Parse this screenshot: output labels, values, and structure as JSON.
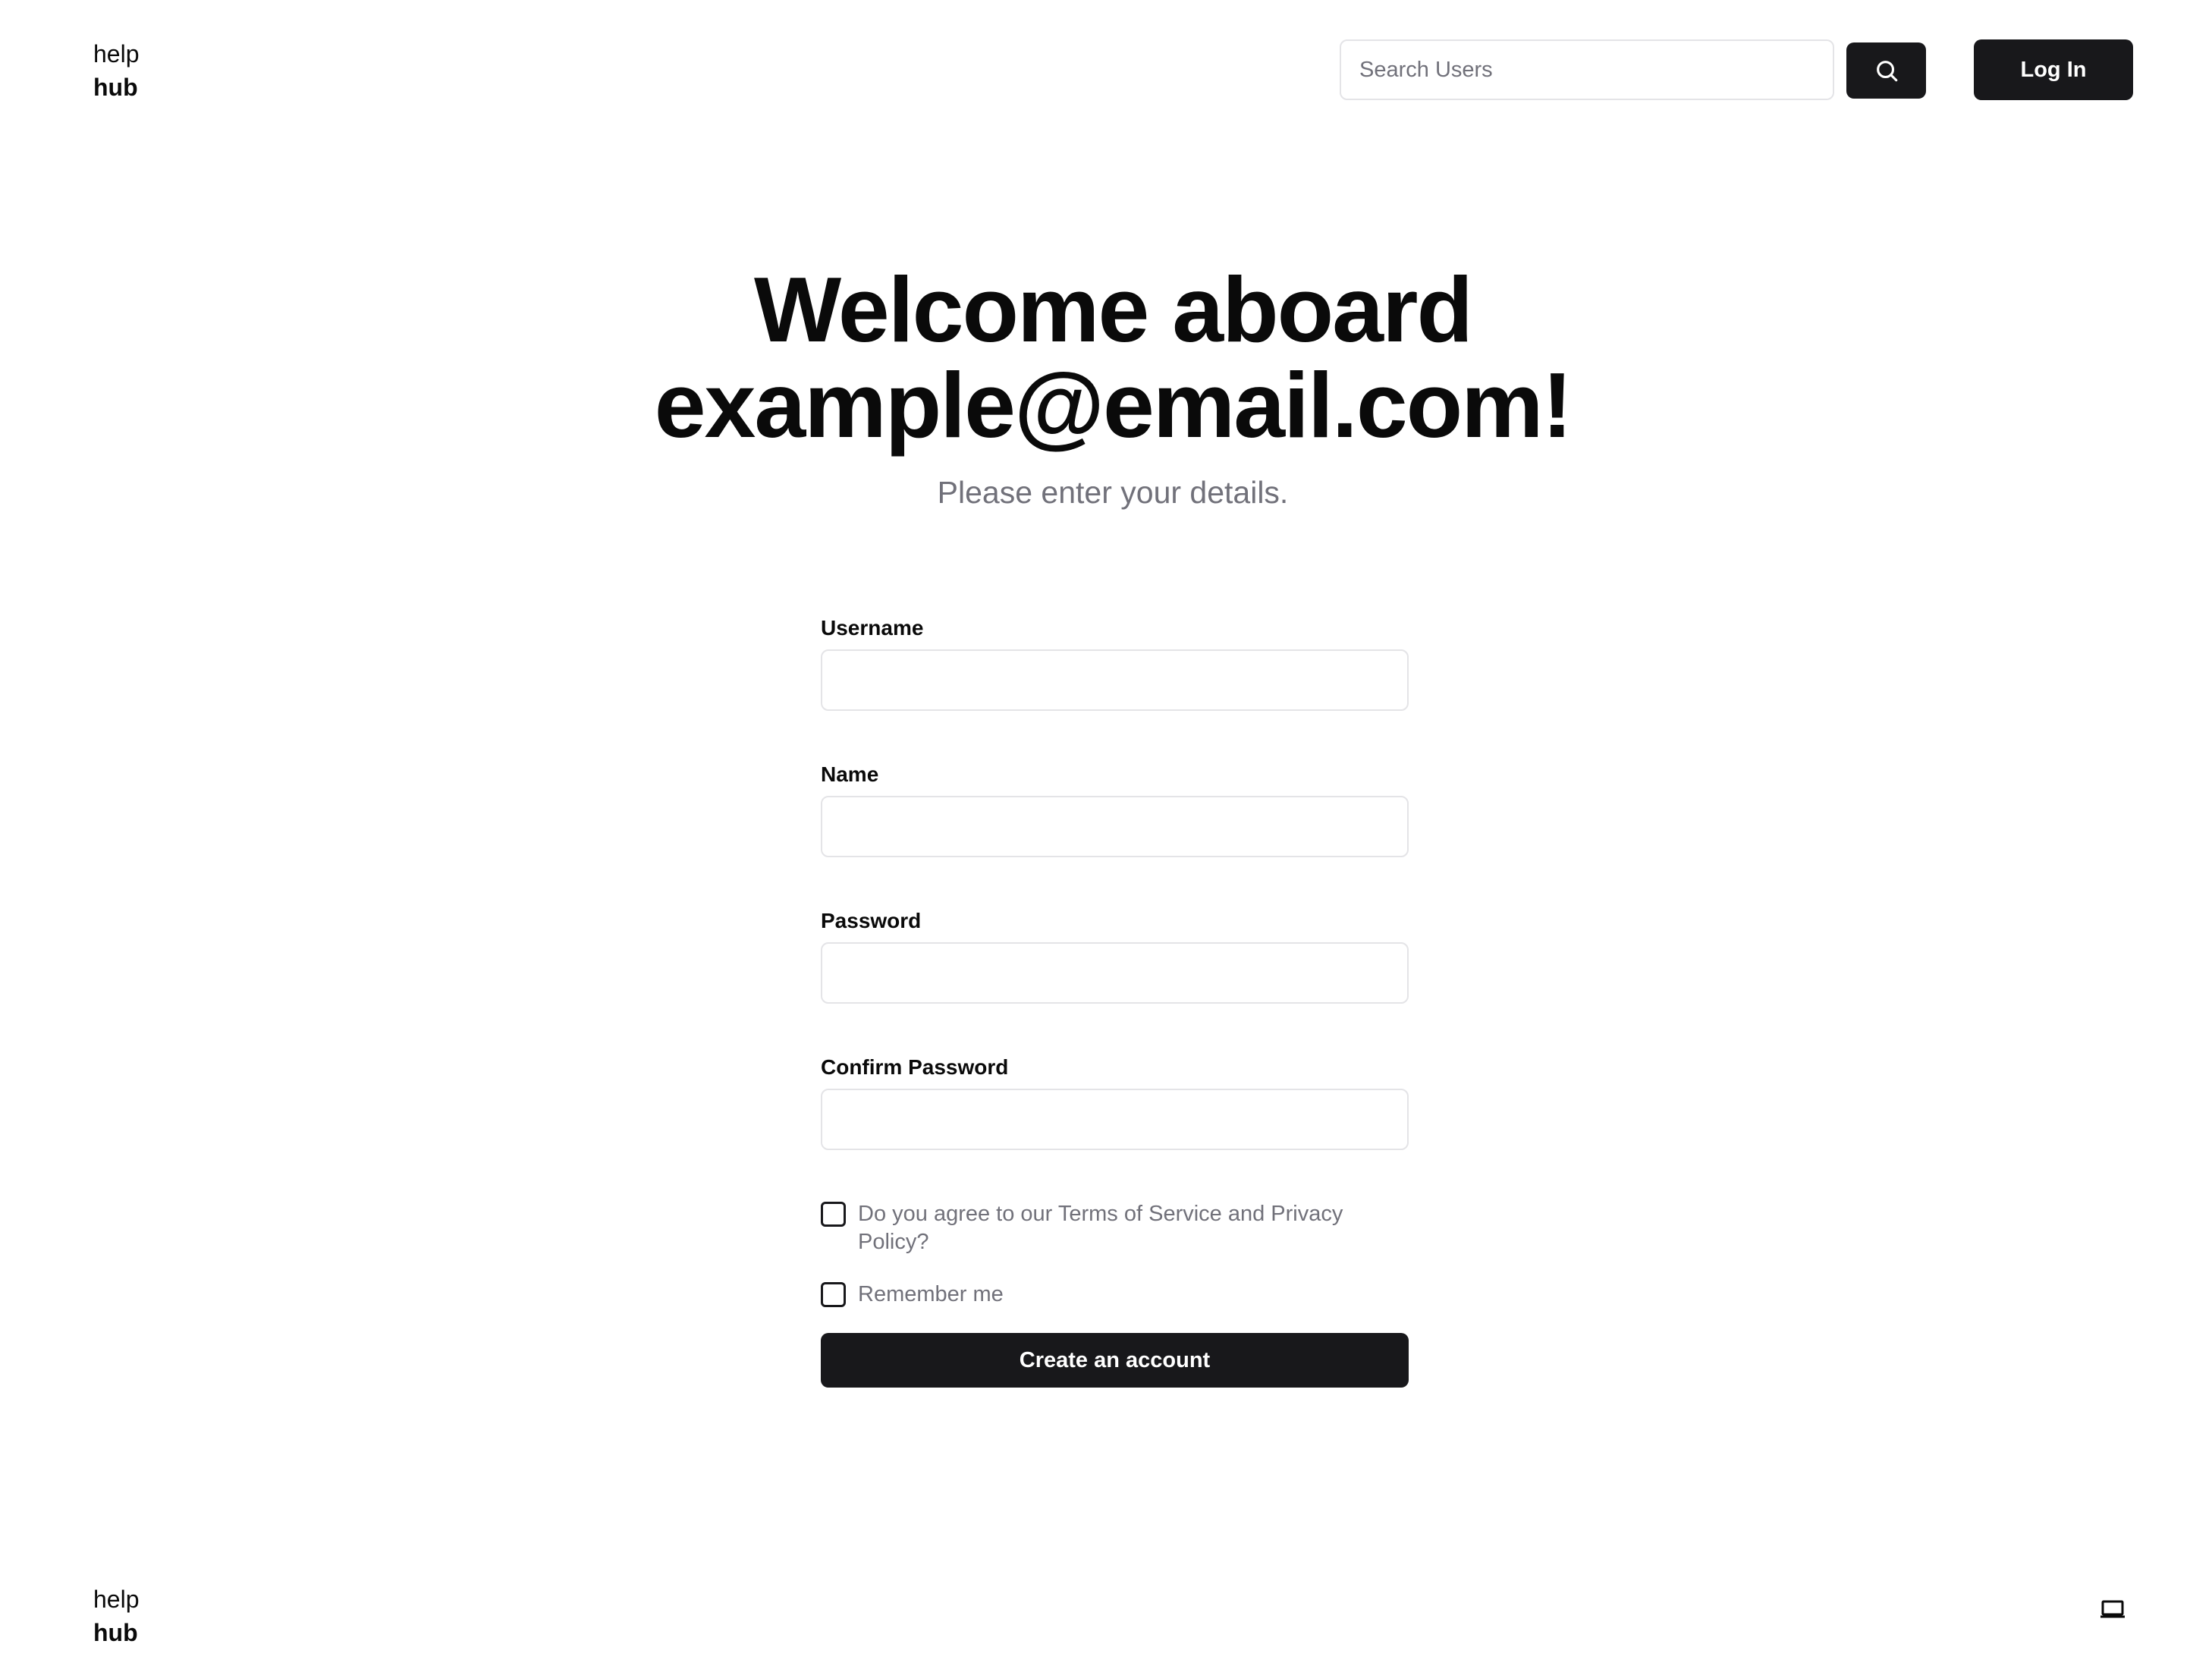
{
  "header": {
    "logo": {
      "line1": "help",
      "line2": "hub"
    },
    "search": {
      "placeholder": "Search Users",
      "icon": "search-icon"
    },
    "login_label": "Log In"
  },
  "hero": {
    "title_line1": "Welcome aboard",
    "title_line2": "example@email.com!",
    "subtitle": "Please enter your details."
  },
  "form": {
    "fields": [
      {
        "label": "Username",
        "value": ""
      },
      {
        "label": "Name",
        "value": ""
      },
      {
        "label": "Password",
        "value": ""
      },
      {
        "label": "Confirm Password",
        "value": ""
      }
    ],
    "terms_label": "Do you agree to our Terms of Service and Privacy Policy?",
    "remember_label": "Remember me",
    "submit_label": "Create an account"
  },
  "footer": {
    "logo": {
      "line1": "help",
      "line2": "hub"
    },
    "icon": "laptop-icon"
  },
  "colors": {
    "primary": "#18181b",
    "muted_text": "#71717a",
    "border": "#e4e4e7",
    "background": "#ffffff"
  }
}
